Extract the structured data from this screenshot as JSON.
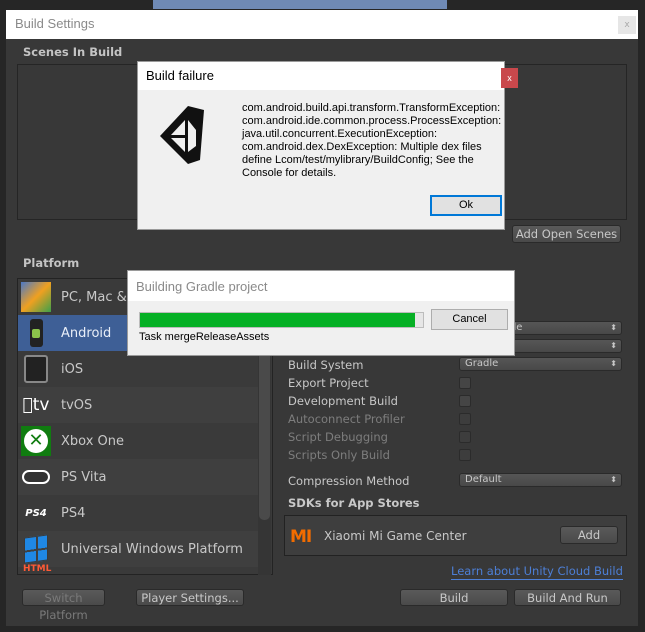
{
  "window": {
    "title": "Build Settings",
    "close": "x"
  },
  "scenes": {
    "header": "Scenes In Build",
    "add_open_scenes": "Add Open Scenes"
  },
  "platform": {
    "header": "Platform",
    "items": [
      {
        "label": "PC, Mac & Linux Standalone",
        "icon": "pc-mac-linux-icon"
      },
      {
        "label": "Android",
        "icon": "android-icon",
        "selected": true
      },
      {
        "label": "iOS",
        "icon": "ios-icon"
      },
      {
        "label": "tvOS",
        "icon": "apple-tv-icon",
        "icon_text": "tv"
      },
      {
        "label": "Xbox One",
        "icon": "xbox-icon"
      },
      {
        "label": "PS Vita",
        "icon": "ps-vita-icon"
      },
      {
        "label": "PS4",
        "icon": "ps4-icon",
        "icon_text": "PS4"
      },
      {
        "label": "Universal Windows Platform",
        "icon": "windows-icon"
      },
      {
        "label": "",
        "icon": "html5-icon",
        "icon_text": "HTML"
      }
    ]
  },
  "settings": {
    "texture_compression_value": "ride",
    "build_system_label": "Build System",
    "build_system_value": "Gradle",
    "export_project": "Export Project",
    "development_build": "Development Build",
    "autoconnect_profiler": "Autoconnect Profiler",
    "script_debugging": "Script Debugging",
    "scripts_only_build": "Scripts Only Build",
    "compression_label": "Compression Method",
    "compression_value": "Default",
    "sdk_header": "SDKs for App Stores",
    "sdk_name": "Xiaomi Mi Game Center",
    "sdk_add": "Add",
    "cloud_link": "Learn about Unity Cloud Build"
  },
  "footer": {
    "switch_platform": "Switch Platform",
    "player_settings": "Player Settings...",
    "build": "Build",
    "build_and_run": "Build And Run"
  },
  "failure_dialog": {
    "title": "Build failure",
    "close": "x",
    "message": "com.android.build.api.transform.TransformException: com.android.ide.common.process.ProcessException: java.util.concurrent.ExecutionException: com.android.dex.DexException: Multiple dex files define Lcom/test/mylibrary/BuildConfig; See the Console for details.",
    "ok": "Ok"
  },
  "progress_dialog": {
    "title": "Building Gradle project",
    "progress_percent": 97,
    "task": "Task mergeReleaseAssets",
    "cancel": "Cancel",
    "bar_color": "#06b025"
  },
  "colors": {
    "selected": "#3e5f96",
    "link": "#4d7fd6",
    "mi_brand": "#f26c00"
  }
}
